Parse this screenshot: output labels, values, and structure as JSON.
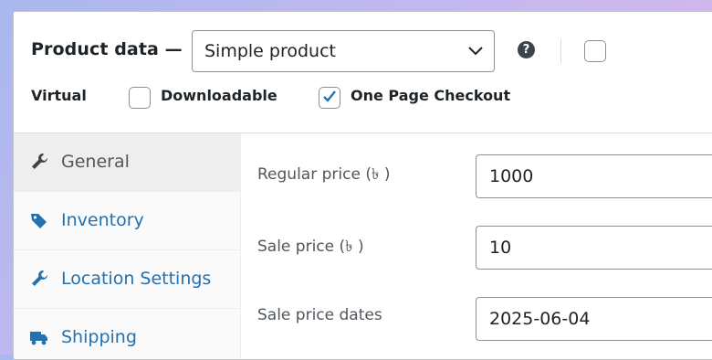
{
  "header": {
    "title": "Product data —",
    "product_type": "Simple product",
    "help_symbol": "?",
    "options": [
      {
        "label": "Virtual",
        "checked": false
      },
      {
        "label": "Downloadable",
        "checked": false
      },
      {
        "label": "One Page Checkout",
        "checked": true
      }
    ]
  },
  "tabs": [
    {
      "label": "General",
      "icon": "wrench-icon",
      "active": true
    },
    {
      "label": "Inventory",
      "icon": "tag-icon",
      "active": false
    },
    {
      "label": "Location Settings",
      "icon": "wrench-icon",
      "active": false
    },
    {
      "label": "Shipping",
      "icon": "truck-icon",
      "active": false
    }
  ],
  "fields": {
    "regular_price": {
      "label": "Regular price (৳ )",
      "value": "1000"
    },
    "sale_price": {
      "label": "Sale price (৳ )",
      "value": "10"
    },
    "sale_price_dates": {
      "label": "Sale price dates",
      "value": "2025-06-04"
    }
  },
  "colors": {
    "link": "#2271b1",
    "checkbox_check": "#2271b1",
    "border": "#8c8f94"
  }
}
